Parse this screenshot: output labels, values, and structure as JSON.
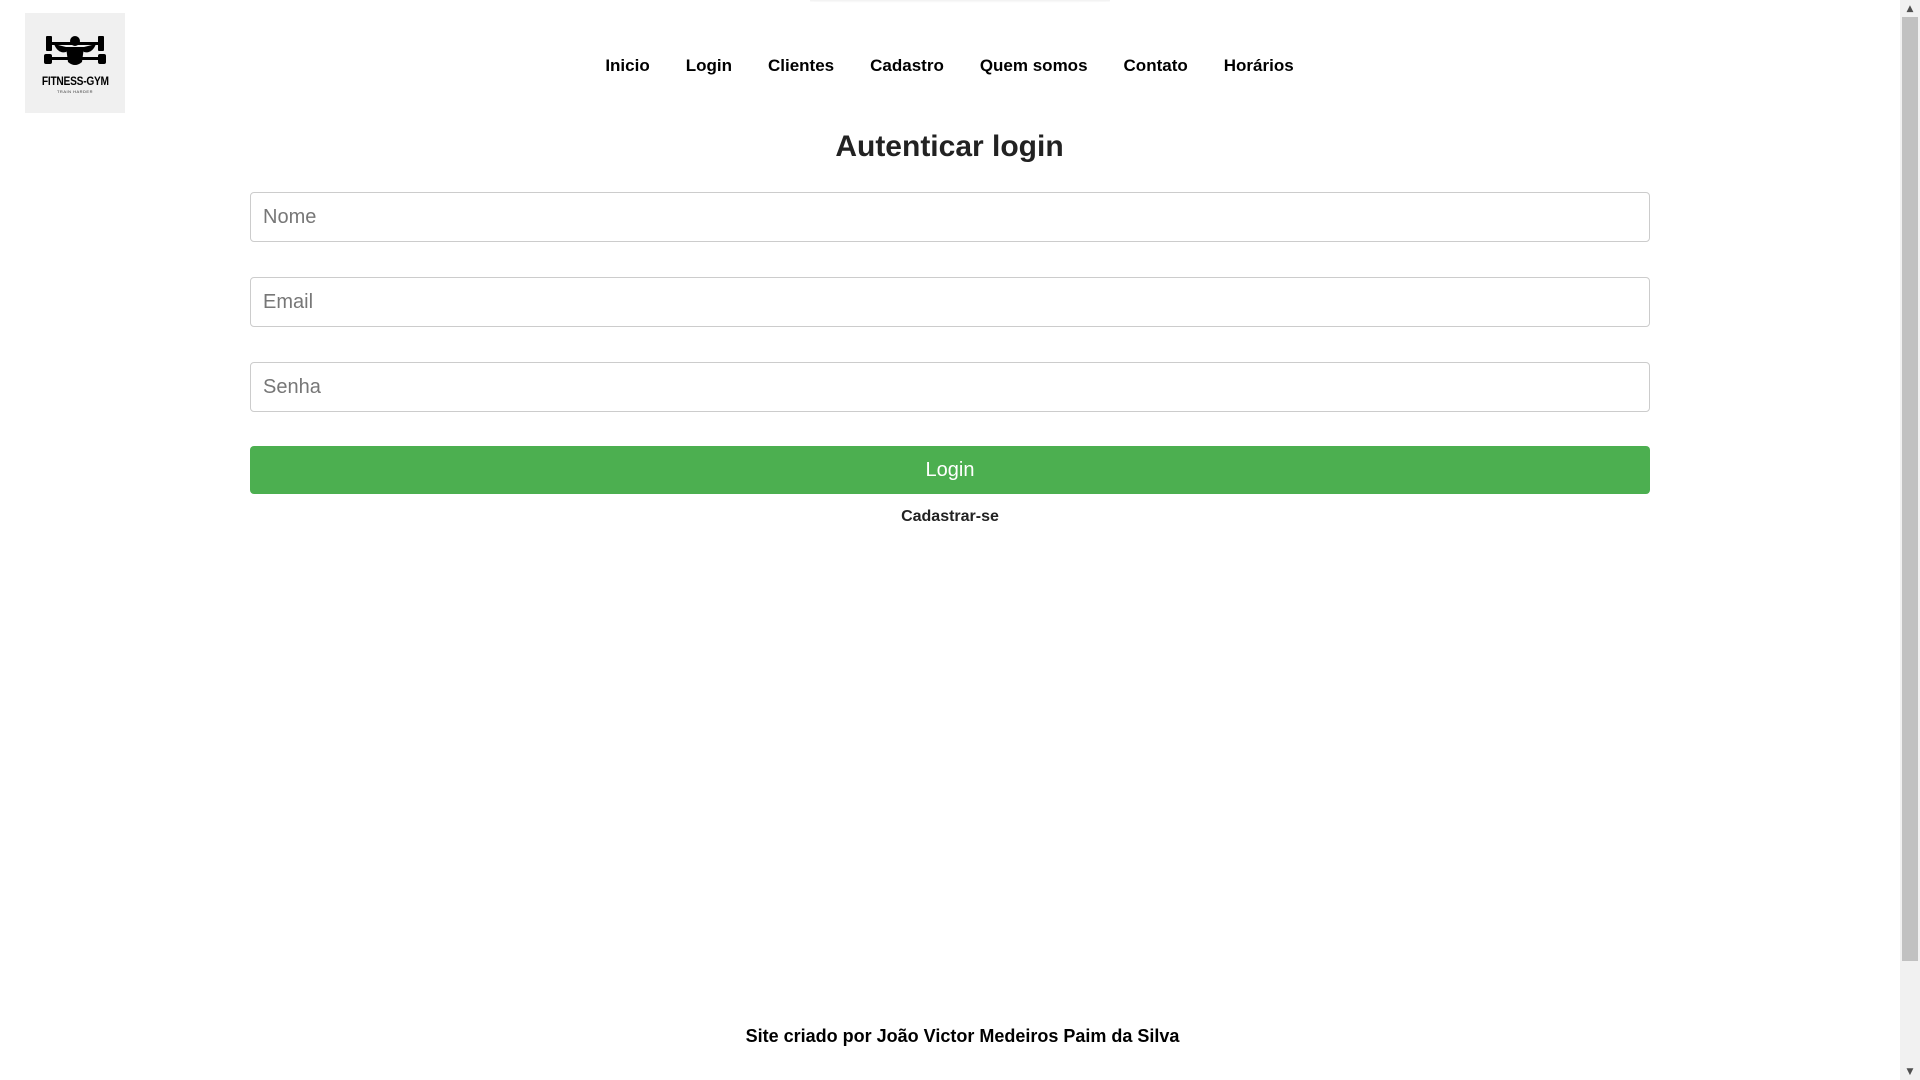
{
  "logo": {
    "text": "FITNESS-GYM",
    "tagline": "TRAIN HARDER",
    "icon": "bodybuilder-icon"
  },
  "nav": {
    "items": [
      "Inicio",
      "Login",
      "Clientes",
      "Cadastro",
      "Quem somos",
      "Contato",
      "Horários"
    ]
  },
  "main": {
    "title": "Autenticar login",
    "fields": {
      "name_placeholder": "Nome",
      "email_placeholder": "Email",
      "password_placeholder": "Senha"
    },
    "login_button": "Login",
    "register_link": "Cadastrar-se"
  },
  "footer": {
    "text": "Site criado por João Victor Medeiros Paim da Silva"
  },
  "colors": {
    "primary_button": "#4caf50",
    "logo_background": "#f0f0f0"
  }
}
